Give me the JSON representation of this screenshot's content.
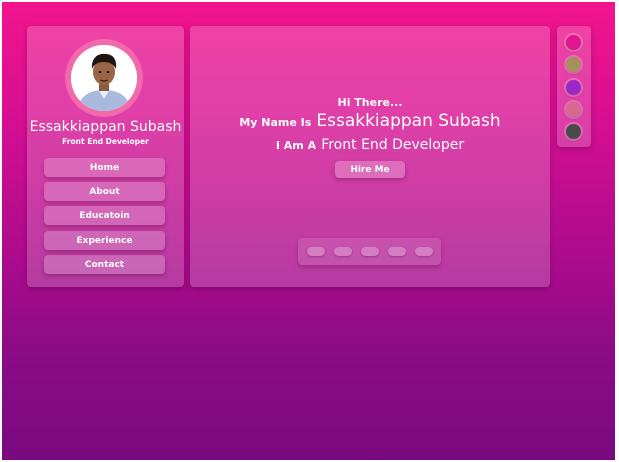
{
  "profile": {
    "name": "Essakkiappan Subash",
    "role": "Front End Developer"
  },
  "nav": [
    {
      "label": "Home"
    },
    {
      "label": "About"
    },
    {
      "label": "Educatoin"
    },
    {
      "label": "Experience"
    },
    {
      "label": "Contact"
    }
  ],
  "hero": {
    "greeting": "Hi There...",
    "name_prefix": "My Name Is",
    "name": "Essakkiappan Subash",
    "role_prefix": "I Am A",
    "role": "Front End Developer",
    "hire_label": "Hire Me"
  },
  "theme_swatches": [
    {
      "name": "pink",
      "color": "#e0158f"
    },
    {
      "name": "olive",
      "color": "#a8905c"
    },
    {
      "name": "purple",
      "color": "#9a27c8"
    },
    {
      "name": "coral",
      "color": "#d8688f"
    },
    {
      "name": "dark-gray",
      "color": "#4a4a4a"
    }
  ],
  "colors": {
    "background_top": "#f2148d",
    "background_bottom": "#7a0a80"
  }
}
